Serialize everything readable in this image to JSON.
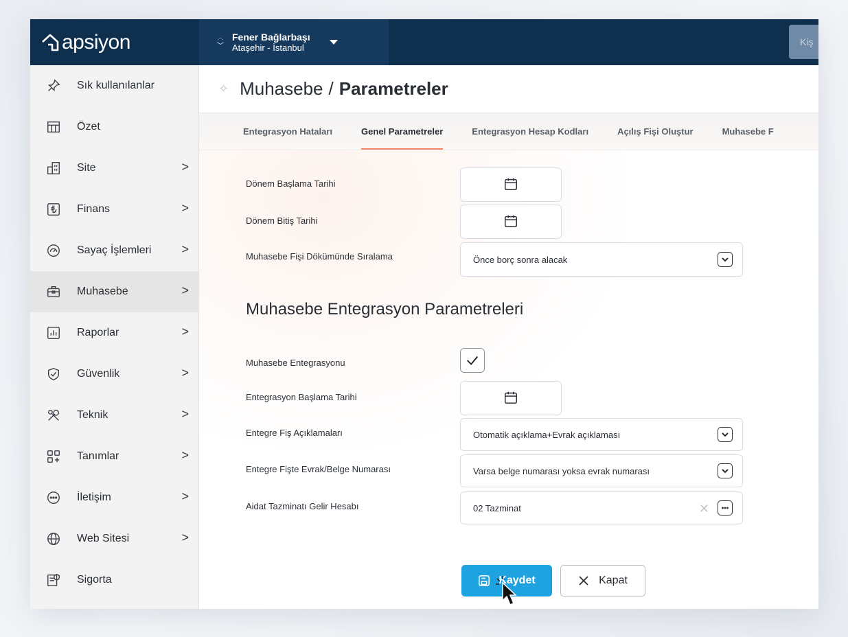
{
  "brand": {
    "name": "apsiyon"
  },
  "site": {
    "name": "Fener Bağlarbaşı",
    "location": "Ataşehir - İstanbul"
  },
  "top_button": {
    "label": "Kiş"
  },
  "sidebar": {
    "items": [
      {
        "label": "Sık kullanılanlar",
        "icon": "pin-icon",
        "arrow": false
      },
      {
        "label": "Özet",
        "icon": "table-icon",
        "arrow": false
      },
      {
        "label": "Site",
        "icon": "building-icon",
        "arrow": true
      },
      {
        "label": "Finans",
        "icon": "lira-icon",
        "arrow": true
      },
      {
        "label": "Sayaç İşlemleri",
        "icon": "gauge-icon",
        "arrow": true
      },
      {
        "label": "Muhasebe",
        "icon": "briefcase-icon",
        "arrow": true,
        "active": true
      },
      {
        "label": "Raporlar",
        "icon": "report-icon",
        "arrow": true
      },
      {
        "label": "Güvenlik",
        "icon": "shield-icon",
        "arrow": true
      },
      {
        "label": "Teknik",
        "icon": "tools-icon",
        "arrow": true
      },
      {
        "label": "Tanımlar",
        "icon": "grid-plus-icon",
        "arrow": true
      },
      {
        "label": "İletişim",
        "icon": "chat-icon",
        "arrow": true
      },
      {
        "label": "Web Sitesi",
        "icon": "globe-icon",
        "arrow": true
      },
      {
        "label": "Sigorta",
        "icon": "insurance-icon",
        "arrow": false
      }
    ],
    "arrow_glyph": ">"
  },
  "header": {
    "crumb": "Muhasebe",
    "separator": "/",
    "current": "Parametreler"
  },
  "tabs": [
    {
      "label": "Entegrasyon Hataları"
    },
    {
      "label": "Genel Parametreler",
      "active": true
    },
    {
      "label": "Entegrasyon Hesap Kodları"
    },
    {
      "label": "Açılış Fişi Oluştur"
    },
    {
      "label": "Muhasebe F"
    }
  ],
  "form": {
    "period_start_label": "Dönem Başlama Tarihi",
    "period_end_label": "Dönem Bitiş Tarihi",
    "sort_label": "Muhasebe Fişi Dökümünde Sıralama",
    "sort_value": "Önce borç sonra alacak",
    "section_title": "Muhasebe Entegrasyon Parametreleri",
    "integration_label": "Muhasebe Entegrasyonu",
    "integration_checked": true,
    "integration_start_label": "Entegrasyon Başlama Tarihi",
    "desc_label": "Entegre Fiş Açıklamaları",
    "desc_value": "Otomatik açıklama+Evrak açıklaması",
    "docno_label": "Entegre Fişte Evrak/Belge Numarası",
    "docno_value": "Varsa belge numarası yoksa evrak numarası",
    "account_label": "Aidat Tazminatı Gelir Hesabı",
    "account_value": "02 Tazminat"
  },
  "buttons": {
    "save": "Kaydet",
    "close": "Kapat"
  },
  "colors": {
    "topbar": "#0f2f4e",
    "accent": "#1ea3e0",
    "tab_underline": "#f0856a"
  }
}
